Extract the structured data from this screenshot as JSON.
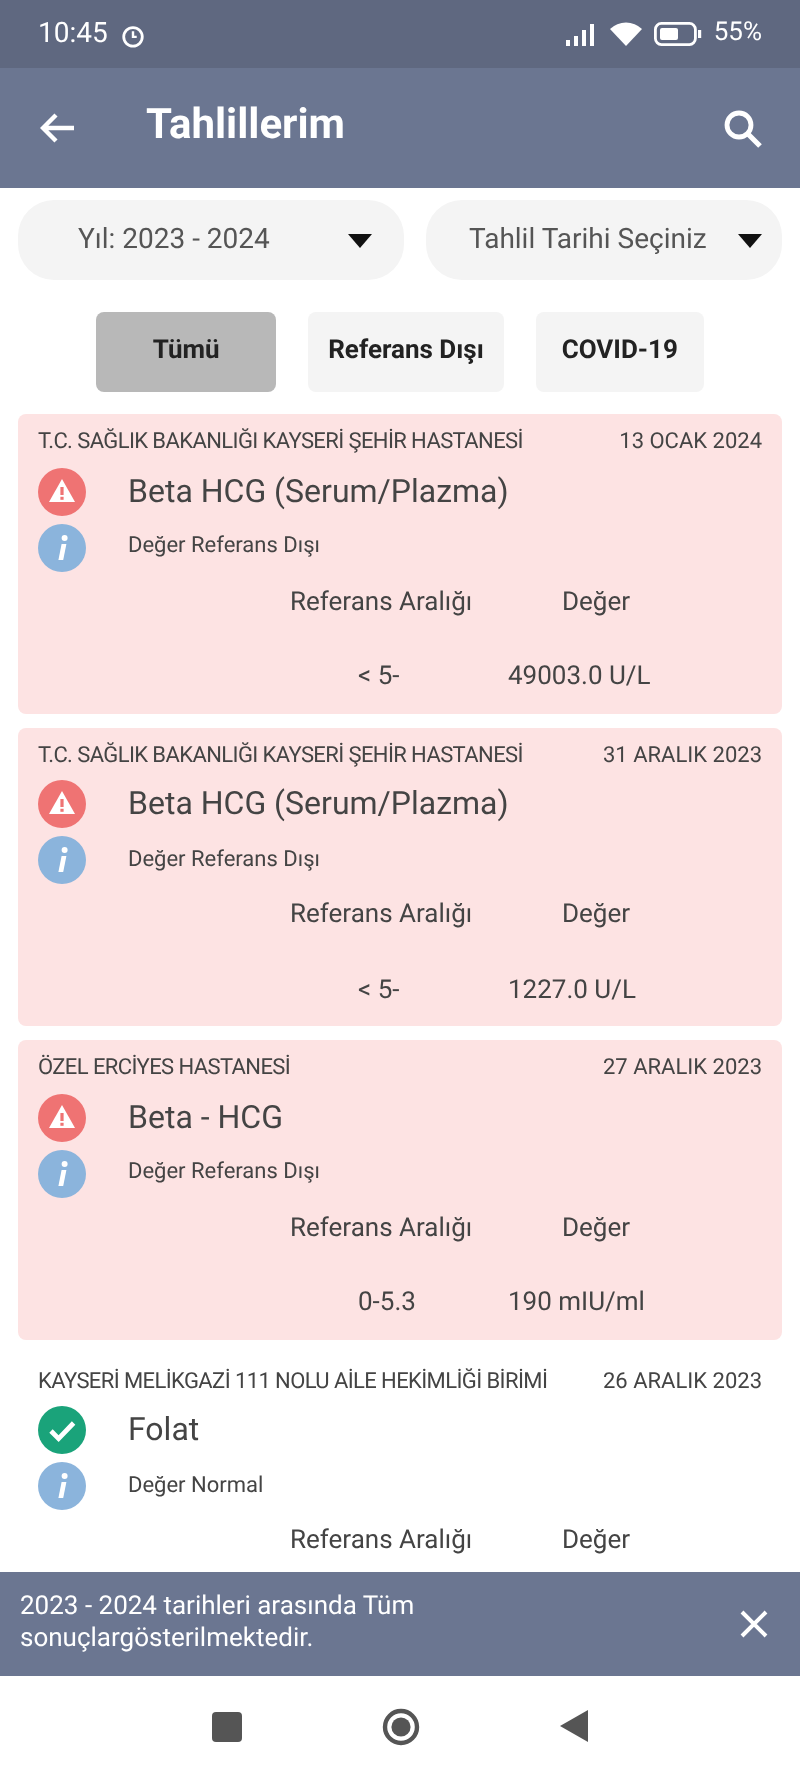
{
  "status_bar": {
    "time": "10:45",
    "battery": "55%"
  },
  "app_bar": {
    "title": "Tahlillerim"
  },
  "filters": {
    "year": "Yıl: 2023 - 2024",
    "date_placeholder": "Tahlil Tarihi Seçiniz"
  },
  "tabs": [
    {
      "label": "Tümü",
      "selected": true
    },
    {
      "label": "Referans Dışı",
      "selected": false
    },
    {
      "label": "COVID-19",
      "selected": false
    }
  ],
  "results": [
    {
      "kind": "abnormal",
      "hospital": "T.C. SAĞLIK BAKANLIĞI KAYSERİ ŞEHİR HASTANESİ",
      "date": "13 OCAK 2024",
      "test": "Beta HCG (Serum/Plazma)",
      "status": "Değer Referans Dışı",
      "range_label": "Referans Aralığı",
      "value_label": "Değer",
      "range": "< 5-",
      "value": "49003.0 U/L"
    },
    {
      "kind": "abnormal",
      "hospital": "T.C. SAĞLIK BAKANLIĞI KAYSERİ ŞEHİR HASTANESİ",
      "date": "31 ARALIK 2023",
      "test": "Beta HCG (Serum/Plazma)",
      "status": "Değer Referans Dışı",
      "range_label": "Referans Aralığı",
      "value_label": "Değer",
      "range": "< 5-",
      "value": "1227.0 U/L"
    },
    {
      "kind": "abnormal",
      "hospital": "ÖZEL ERCİYES HASTANESİ",
      "date": "27 ARALIK 2023",
      "test": "Beta - HCG",
      "status": "Değer Referans Dışı",
      "range_label": "Referans Aralığı",
      "value_label": "Değer",
      "range": "0-5.3",
      "value": "190 mIU/ml"
    },
    {
      "kind": "normal",
      "hospital": "KAYSERİ MELİKGAZİ 111 NOLU AİLE HEKİMLİĞİ BİRİMİ",
      "date": "26 ARALIK 2023",
      "test": "Folat",
      "status": "Değer Normal",
      "range_label": "Referans Aralığı",
      "value_label": "Değer"
    }
  ],
  "snackbar": {
    "message": "2023 - 2024 tarihleri arasında Tüm sonuçlargösterilmektedir."
  }
}
